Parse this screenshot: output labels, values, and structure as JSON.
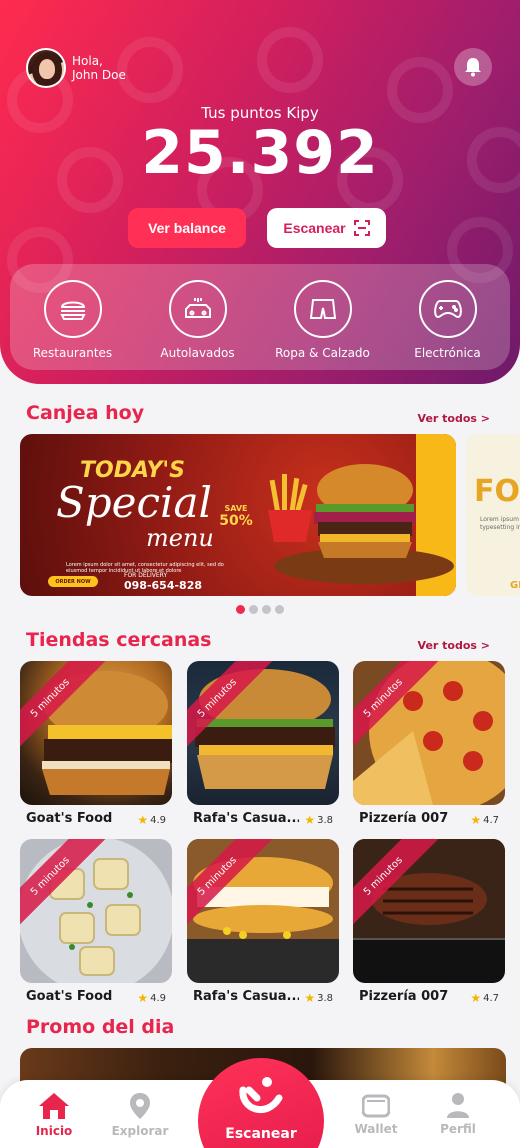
{
  "header": {
    "greeting": "Hola,",
    "user_name": "John Doe",
    "points_label": "Tus puntos Kipy",
    "points_value": "25.392",
    "balance_button": "Ver balance",
    "scan_button": "Escanear"
  },
  "categories": [
    {
      "label": "Restaurantes",
      "icon": "burger-icon"
    },
    {
      "label": "Autolavados",
      "icon": "car-wash-icon"
    },
    {
      "label": "Ropa & Calzado",
      "icon": "shorts-icon"
    },
    {
      "label": "Electrónica",
      "icon": "gamepad-icon"
    }
  ],
  "redeem": {
    "title": "Canjea hoy",
    "see_all": "Ver todos >",
    "banner": {
      "today": "TODAY'S",
      "special": "Special",
      "menu": "menu",
      "lorem": "Lorem ipsum dolor sit amet, consectetur adipiscing elit, sed do eiusmod tempor incididunt ut labore et dolore",
      "order": "ORDER NOW",
      "delivery": "FOR DELIVERY",
      "phone": "098-654-828",
      "save": "SAVE",
      "save_pct": "50%"
    },
    "banner2": {
      "title": "FOO",
      "sub": "Lorem ipsum typesetting in",
      "tail": "GE"
    },
    "dots": 4,
    "active_dot": 0
  },
  "nearby": {
    "title": "Tiendas cercanas",
    "see_all": "Ver todos >",
    "badge": "5 minutos",
    "stores": [
      {
        "name": "Goat's Food",
        "rating": "4.9"
      },
      {
        "name": "Rafa's Casua...",
        "rating": "3.8"
      },
      {
        "name": "Pizzería 007",
        "rating": "4.7"
      },
      {
        "name": "Goat's Food",
        "rating": "4.9"
      },
      {
        "name": "Rafa's Casua...",
        "rating": "3.8"
      },
      {
        "name": "Pizzería 007",
        "rating": "4.7"
      }
    ]
  },
  "promo": {
    "title": "Promo del dia"
  },
  "nav": {
    "home": "Inicio",
    "explore": "Explorar",
    "scan": "Escanear",
    "wallet": "Wallet",
    "profile": "Perfil"
  },
  "colors": {
    "accent": "#e8254d",
    "gradient_start": "#ff2b4e",
    "gradient_end": "#6e1a6a"
  }
}
